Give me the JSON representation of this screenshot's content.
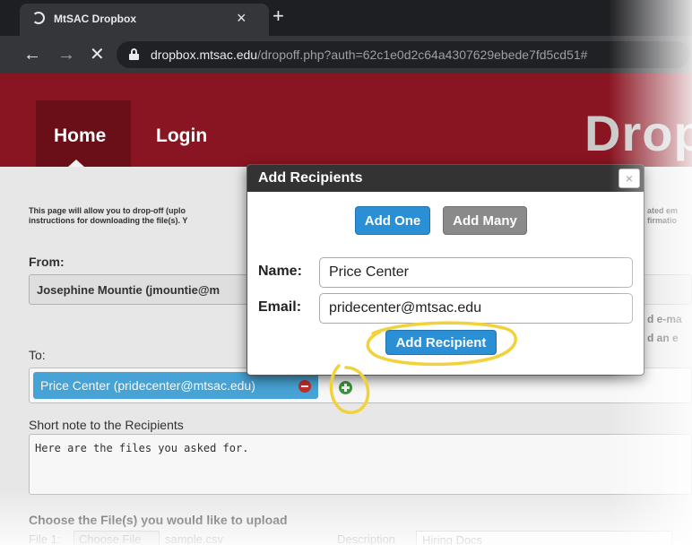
{
  "browser": {
    "tab_title": "MtSAC Dropbox",
    "tab_close": "×",
    "new_tab": "+",
    "back": "←",
    "forward": "→",
    "stop": "✕",
    "url_host": "dropbox.mtsac.edu",
    "url_path": "/dropoff.php?auth=62c1e0d2c64a4307629ebede7fd5cd51#"
  },
  "header": {
    "nav": [
      "Home",
      "Login"
    ],
    "brand": "Drop",
    "color": "#8a1522"
  },
  "page": {
    "intro_line1": "This page will allow you to drop-off (uplo",
    "intro_line2": "instructions for downloading the file(s). Y",
    "intro_right": "ated em\nfirmatio",
    "from_label": "From:",
    "from_value": "Josephine Mountie  (jmountie@m",
    "side_note": "d e-ma\nd an e",
    "to_label": "To:",
    "recipient_chip": "Price Center (pridecenter@mtsac.edu)",
    "note_label": "Short note to the Recipients",
    "note_text": "Here are the files you asked for.",
    "files_label": "Choose the File(s) you would like to upload",
    "file_row": {
      "file_label": "File 1:",
      "choose_button": "Choose File",
      "filename": "sample.csv",
      "description_label": "Description",
      "description_value": "Hiring Docs"
    }
  },
  "dialog": {
    "title": "Add Recipients",
    "close": "×",
    "add_one": "Add One",
    "add_many": "Add Many",
    "name_label": "Name:",
    "name_value": "Price Center",
    "email_label": "Email:",
    "email_value": "pridecenter@mtsac.edu",
    "add_recipient": "Add Recipient"
  },
  "colors": {
    "accent_blue": "#2b8fd6",
    "chip_blue": "#4aa9dc",
    "annotation_yellow": "#f2d23a"
  }
}
